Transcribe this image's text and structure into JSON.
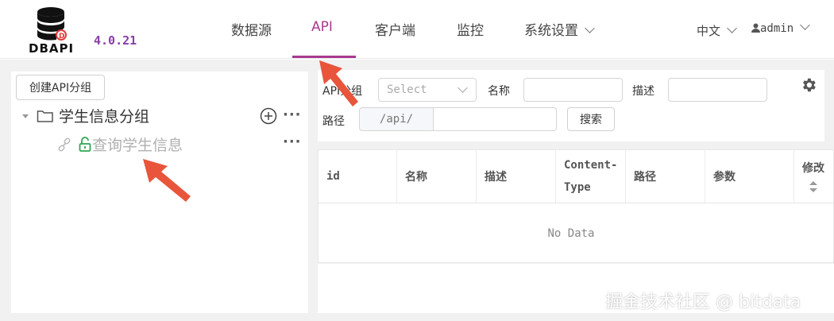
{
  "app": {
    "logo_text": "DBAPI",
    "version": "4.0.21"
  },
  "nav": {
    "items": [
      {
        "label": "数据源"
      },
      {
        "label": "API"
      },
      {
        "label": "客户端"
      },
      {
        "label": "监控"
      },
      {
        "label": "系统设置"
      }
    ],
    "active": "API",
    "language": "中文",
    "user": "admin"
  },
  "left": {
    "create_group_button": "创建API分组",
    "tree": {
      "group_label": "学生信息分组",
      "child_label": "查询学生信息"
    }
  },
  "search": {
    "group_label": "API分组",
    "group_placeholder": "Select",
    "name_label": "名称",
    "desc_label": "描述",
    "path_label": "路径",
    "path_prefix": "/api/",
    "search_button": "搜索"
  },
  "table": {
    "columns": [
      "id",
      "名称",
      "描述",
      "Content-Type",
      "路径",
      "参数",
      "修改"
    ],
    "empty_text": "No Data"
  },
  "watermark": "掘金技术社区 @ bitdata",
  "colors": {
    "accent": "#a83a8f",
    "version": "#8a3fa8",
    "arrow": "#e8553b",
    "lock": "#2fa84f"
  }
}
